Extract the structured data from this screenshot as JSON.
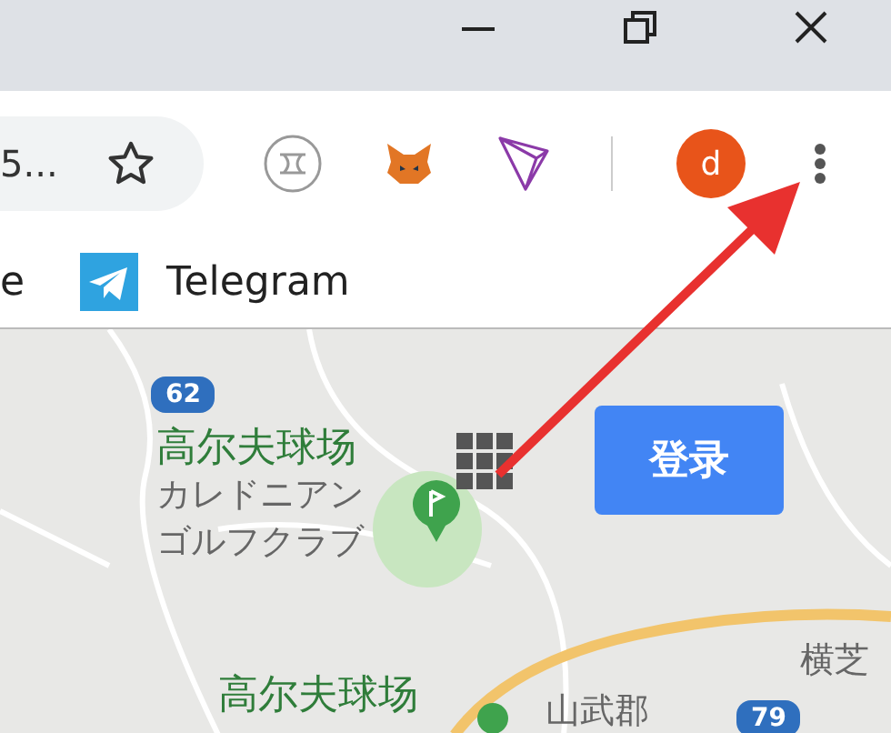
{
  "toolbar": {
    "omnibox_text": "5...",
    "avatar_letter": "d"
  },
  "bookmarks": [
    {
      "label": "e",
      "kind": "text"
    },
    {
      "label": "Telegram",
      "kind": "telegram"
    }
  ],
  "map": {
    "labels": [
      {
        "kind": "route",
        "text": "62"
      },
      {
        "kind": "place",
        "text": "高尔夫球场"
      },
      {
        "kind": "sub",
        "text": "カレドニアン"
      },
      {
        "kind": "sub",
        "text": "ゴルフクラブ"
      },
      {
        "kind": "sub",
        "text": "横芝"
      },
      {
        "kind": "place",
        "text": "高尔夫球场"
      },
      {
        "kind": "sub",
        "text": "山武郡"
      },
      {
        "kind": "route",
        "text": "79"
      }
    ],
    "login_button": "登录"
  }
}
